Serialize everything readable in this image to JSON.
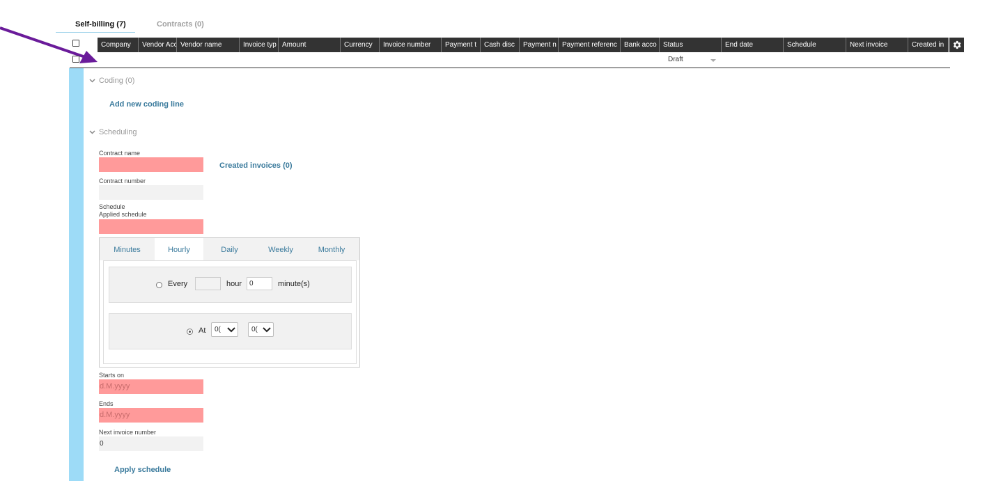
{
  "tabs": [
    {
      "label": "Self-billing (7)",
      "active": true
    },
    {
      "label": "Contracts (0)",
      "active": false
    }
  ],
  "grid": {
    "columns": [
      "Company",
      "Vendor Acc",
      "Vendor name",
      "Invoice typ",
      "Amount",
      "Currency",
      "Invoice number",
      "Payment t",
      "Cash disc",
      "Payment n",
      "Payment referenc",
      "Bank acco",
      "Status",
      "End date",
      "Schedule",
      "Next invoice",
      "Created in"
    ],
    "status_filter": "Draft"
  },
  "coding": {
    "title": "Coding (0)",
    "add_line": "Add new coding line"
  },
  "scheduling": {
    "title": "Scheduling",
    "contract_name_label": "Contract name",
    "contract_name_value": "",
    "created_invoices": "Created invoices (0)",
    "contract_number_label": "Contract number",
    "contract_number_value": "",
    "schedule_label": "Schedule",
    "applied_schedule_label": "Applied schedule",
    "applied_schedule_value": "",
    "schedule_tabs": [
      "Minutes",
      "Hourly",
      "Daily",
      "Weekly",
      "Monthly"
    ],
    "active_schedule_tab": "Hourly",
    "every": {
      "label": "Every",
      "hour_value": "",
      "hour_label": "hour",
      "minute_value": "0",
      "minute_label": "minute(s)"
    },
    "at": {
      "label": "At",
      "hour_select": "0(",
      "minute_select": "0("
    },
    "starts_on_label": "Starts on",
    "starts_on_placeholder": "d.M.yyyy",
    "ends_label": "Ends",
    "ends_placeholder": "d.M.yyyy",
    "next_invoice_label": "Next invoice number",
    "next_invoice_value": "0",
    "apply_button": "Apply schedule"
  },
  "colors": {
    "accent_bar": "#9ddbf7",
    "required_field": "#ff9a9a",
    "link": "#3a7a9c",
    "header_bg": "#333333",
    "annotation_arrow": "#6a1b9a"
  }
}
